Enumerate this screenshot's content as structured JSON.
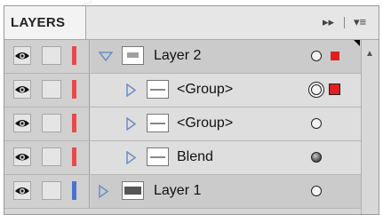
{
  "panel": {
    "tab_label": "LAYERS",
    "fast_forward_glyph": "▸▸",
    "menu_glyph": "▾≡"
  },
  "rows": [
    {
      "kind": "layer",
      "label": "Layer 2",
      "expanded": true,
      "bar_color": "#e84a4a",
      "target": "plain",
      "selected_square": "small"
    },
    {
      "kind": "sub",
      "label": "<Group>",
      "bar_color": "#e84a4a",
      "target": "double",
      "selected_square": "big"
    },
    {
      "kind": "sub",
      "label": "<Group>",
      "bar_color": "#e84a4a",
      "target": "plain",
      "selected_square": "none"
    },
    {
      "kind": "sub",
      "label": "Blend",
      "bar_color": "#e84a4a",
      "target": "filled",
      "selected_square": "none"
    },
    {
      "kind": "layer",
      "label": "Layer 1",
      "expanded": false,
      "bar_color": "#4a74c9",
      "target": "plain",
      "selected_square": "none"
    }
  ],
  "icons": {
    "visibility": "eye-icon",
    "expand_open": "triangle-down-icon",
    "expand_closed": "triangle-right-icon",
    "target": "target-circle-icon"
  }
}
